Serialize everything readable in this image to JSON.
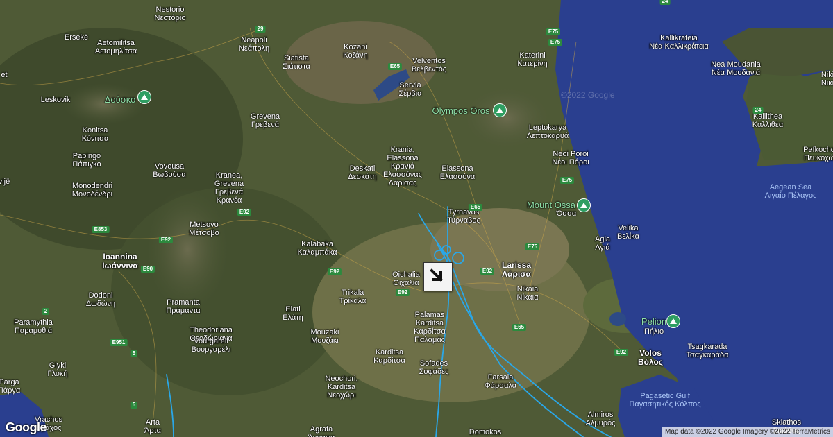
{
  "map": {
    "watermark": "©2022 Google",
    "attribution": "Map data ©2022 Google Imagery ©2022 TerraMetrics",
    "logo": "Google",
    "flight_marker_icon": "arrow-southeast-icon",
    "track_color": "#2aa7e8",
    "water_color": "#2a3f8f",
    "land_color": "#4b5634"
  },
  "places": [
    {
      "id": "nestorio",
      "en": "Nestorio",
      "gr": "Νεστόριο"
    },
    {
      "id": "erseke",
      "en": "Ersekë",
      "gr": ""
    },
    {
      "id": "aetomilitsa",
      "en": "Aetomilitsa",
      "gr": "Αετομηλίτσα"
    },
    {
      "id": "neapoli",
      "en": "Neapoli",
      "gr": "Νεάπολη"
    },
    {
      "id": "kozani",
      "en": "Kozani",
      "gr": "Κοζάνη"
    },
    {
      "id": "siatista",
      "en": "Siatista",
      "gr": "Σιάτιστα"
    },
    {
      "id": "velventos",
      "en": "Velventos",
      "gr": "Βελβεντός"
    },
    {
      "id": "servia",
      "en": "Servia",
      "gr": "Σέρβια"
    },
    {
      "id": "katerini",
      "en": "Katerini",
      "gr": "Κατερίνη"
    },
    {
      "id": "kallikrateia",
      "en": "Kallikrateia",
      "gr": "Νέα Καλλικράτεια"
    },
    {
      "id": "nea_moudania",
      "en": "Nea Moudania",
      "gr": "Νέα Μουδανιά"
    },
    {
      "id": "leskovik",
      "en": "Leskovik",
      "gr": ""
    },
    {
      "id": "grevena",
      "en": "Grevena",
      "gr": "Γρεβενά"
    },
    {
      "id": "leptokarya",
      "en": "Leptokarya",
      "gr": "Λεπτοκαρυά"
    },
    {
      "id": "kallithea",
      "en": "Kallithea",
      "gr": "Καλλιθέα"
    },
    {
      "id": "konitsa",
      "en": "Konitsa",
      "gr": "Κόνιτσα"
    },
    {
      "id": "papingo",
      "en": "Papingo",
      "gr": "Πάπιγκο"
    },
    {
      "id": "krania",
      "en": "Krania,",
      "gr": "Elassona"
    },
    {
      "id": "neoi_poroi",
      "en": "Neoi Poroi",
      "gr": "Νέοι Πόροι"
    },
    {
      "id": "pefkochori",
      "en": "Pefkocho",
      "gr": "Πευκοχώ"
    },
    {
      "id": "vovousa",
      "en": "Vovousa",
      "gr": "Βωβούσα"
    },
    {
      "id": "kranea",
      "en": "Kranea,",
      "gr": "Grevena"
    },
    {
      "id": "deskati",
      "en": "Deskati",
      "gr": "Δεσκάτη"
    },
    {
      "id": "elassona",
      "en": "Elassona",
      "gr": "Ελασσόνα"
    },
    {
      "id": "monodendri",
      "en": "Monodendri",
      "gr": "Μονοδένδρι"
    },
    {
      "id": "metsovo",
      "en": "Metsovo",
      "gr": "Μέτσοβο"
    },
    {
      "id": "tyrnavos",
      "en": "Tyrnavos",
      "gr": "Τύρναβος"
    },
    {
      "id": "velika",
      "en": "Velika",
      "gr": "Βελίκα"
    },
    {
      "id": "agia",
      "en": "Agia",
      "gr": "Αγιά"
    },
    {
      "id": "ioannina",
      "en": "Ioannina",
      "gr": "Ιωάννινα"
    },
    {
      "id": "kalabaka",
      "en": "Kalabaka",
      "gr": "Καλαμπάκα"
    },
    {
      "id": "larissa",
      "en": "Larissa",
      "gr": "Λάρισα"
    },
    {
      "id": "oichalia",
      "en": "Oichalia",
      "gr": "Οιχαλία"
    },
    {
      "id": "trikala",
      "en": "Trikala",
      "gr": "Τρίκαλα"
    },
    {
      "id": "nikaia",
      "en": "Nikaia",
      "gr": "Νίκαια"
    },
    {
      "id": "dodoni",
      "en": "Dodoni",
      "gr": "Δωδώνη"
    },
    {
      "id": "pramanta",
      "en": "Pramanta",
      "gr": "Πράμαντα"
    },
    {
      "id": "elati",
      "en": "Elati",
      "gr": "Ελάτη"
    },
    {
      "id": "palamas",
      "en": "Palamas",
      "gr": "Karditsa"
    },
    {
      "id": "paramythia",
      "en": "Paramythia",
      "gr": "Παραμυθιά"
    },
    {
      "id": "theodoriana",
      "en": "Theodoriana",
      "gr": "Θεοδώριανα"
    },
    {
      "id": "mouzaki",
      "en": "Mouzaki",
      "gr": "Μουζάκι"
    },
    {
      "id": "vourgareli",
      "en": "Vourgareli",
      "gr": "Βουργαρέλι"
    },
    {
      "id": "karditsa",
      "en": "Karditsa",
      "gr": "Καρδίτσα"
    },
    {
      "id": "tsagkarada",
      "en": "Tsagkarada",
      "gr": "Τσαγκαράδα"
    },
    {
      "id": "volos",
      "en": "Volos",
      "gr": "Βόλος"
    },
    {
      "id": "sofades",
      "en": "Sofades",
      "gr": "Σοφάδες"
    },
    {
      "id": "glyki",
      "en": "Glyki",
      "gr": "Γλυκή"
    },
    {
      "id": "neochori",
      "en": "Neochori,",
      "gr": "Karditsa"
    },
    {
      "id": "farsala",
      "en": "Farsala",
      "gr": "Φάρσαλα"
    },
    {
      "id": "parga",
      "en": "Parga",
      "gr": "Πάργα"
    },
    {
      "id": "almiros",
      "en": "Almiros",
      "gr": "Αλμυρός"
    },
    {
      "id": "vrachos",
      "en": "Vrachos",
      "gr": "Βράχος"
    },
    {
      "id": "arta",
      "en": "Arta",
      "gr": "Άρτα"
    },
    {
      "id": "agrafa",
      "en": "Agrafa",
      "gr": "Άγραφα"
    },
    {
      "id": "domokos",
      "en": "Domokos",
      "gr": ""
    },
    {
      "id": "skiathos",
      "en": "Skiathos",
      "gr": "Σκιάθος"
    },
    {
      "id": "niki",
      "en": "Niki",
      "gr": "Νικι"
    },
    {
      "id": "vijë",
      "en": "vijë",
      "gr": ""
    },
    {
      "id": "et",
      "en": "et",
      "gr": ""
    }
  ],
  "extra_lines": {
    "krania_gr": "Κρανιά",
    "krania_gr2": "Ελασσόνας",
    "krania_gr3": "Λάρισας",
    "kranea_gr": "Γρεβενά",
    "kranea_gr2": "Κρανέα",
    "palamas_gr": "Καρδίτσα",
    "palamas_gr2": "Παλαμάς",
    "neochori_gr": "Νεοχώρι"
  },
  "peaks": [
    {
      "id": "dousko",
      "label": "Δούσκο"
    },
    {
      "id": "olympos",
      "label": "Olympos Oros"
    },
    {
      "id": "ossa",
      "label": "Mount Ossa"
    },
    {
      "id": "pelion",
      "label": "Pelion"
    },
    {
      "id": "pelion_gr",
      "label": "Πήλιο"
    },
    {
      "id": "ossa_gr",
      "label": "Όσσα"
    }
  ],
  "water_labels": {
    "aegean_en": "Aegean Sea",
    "aegean_gr": "Αιγαίο Πέλαγος",
    "pagasetic_en": "Pagasetic Gulf",
    "pagasetic_gr": "Παγασητικός Κόλπος"
  },
  "road_shields": [
    {
      "id": "s29",
      "label": "29"
    },
    {
      "id": "s24a",
      "label": "24"
    },
    {
      "id": "s24b",
      "label": "24"
    },
    {
      "id": "s65a",
      "label": "E65"
    },
    {
      "id": "s75a",
      "label": "E75"
    },
    {
      "id": "s75b",
      "label": "E75"
    },
    {
      "id": "s75c",
      "label": "E75"
    },
    {
      "id": "s75d",
      "label": "E75"
    },
    {
      "id": "s65b",
      "label": "E65"
    },
    {
      "id": "s65c",
      "label": "E65"
    },
    {
      "id": "s92a",
      "label": "E92"
    },
    {
      "id": "s92b",
      "label": "E92"
    },
    {
      "id": "s92c",
      "label": "E92"
    },
    {
      "id": "s92d",
      "label": "E92"
    },
    {
      "id": "s92e",
      "label": "E92"
    },
    {
      "id": "s92f",
      "label": "E92"
    },
    {
      "id": "s853",
      "label": "E853"
    },
    {
      "id": "s90",
      "label": "E90"
    },
    {
      "id": "s951",
      "label": "E951"
    },
    {
      "id": "s2",
      "label": "2"
    },
    {
      "id": "s5a",
      "label": "5"
    },
    {
      "id": "s5b",
      "label": "5"
    }
  ]
}
